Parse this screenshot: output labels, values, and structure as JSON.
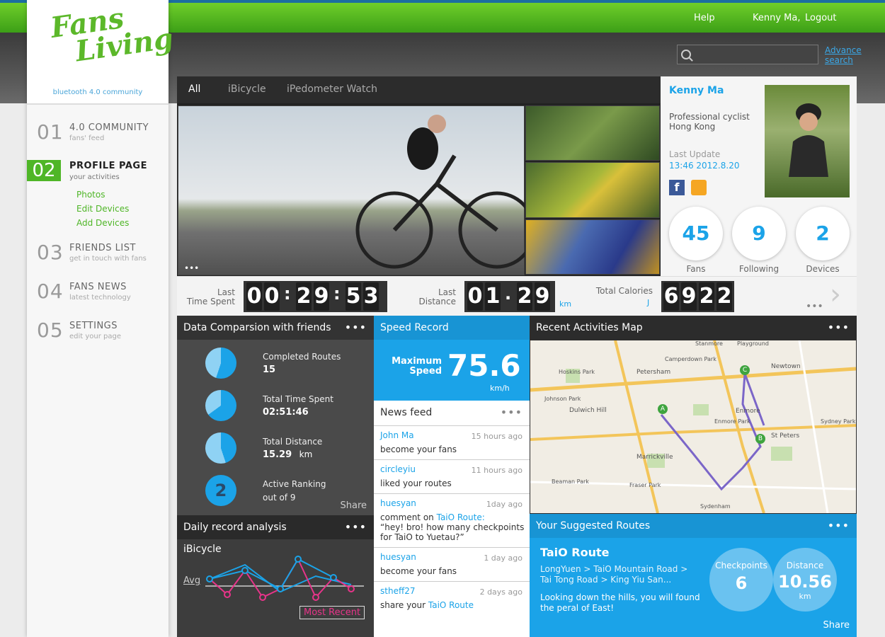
{
  "header": {
    "help": "Help",
    "user": "Kenny Ma,",
    "logout": "Logout",
    "search_placeholder": "",
    "advance_search": "Advance search"
  },
  "brand": {
    "logo_line1": "Fans",
    "logo_line2": "Living",
    "tagline": "bluetooth 4.0 community"
  },
  "nav": [
    {
      "num": "01",
      "title": "4.0 COMMUNITY",
      "sub": "fans' feed"
    },
    {
      "num": "02",
      "title": "PROFILE PAGE",
      "sub": "your activities"
    },
    {
      "num": "03",
      "title": "FRIENDS LIST",
      "sub": "get in touch with fans"
    },
    {
      "num": "04",
      "title": "FANS NEWS",
      "sub": "latest technology"
    },
    {
      "num": "05",
      "title": "SETTINGS",
      "sub": "edit your page"
    }
  ],
  "nav_sublinks": [
    "Photos",
    "Edit Devices",
    "Add Devices"
  ],
  "tabs": [
    "All",
    "iBicycle",
    "iPedometer Watch"
  ],
  "photos_more": "•••",
  "profile": {
    "name": "Kenny Ma",
    "role": "Professional cyclist",
    "location": "Hong Kong",
    "last_update_label": "Last Update",
    "last_update": "13:46 2012.8.20",
    "stats": [
      {
        "value": "45",
        "label": "Fans"
      },
      {
        "value": "9",
        "label": "Following"
      },
      {
        "value": "2",
        "label": "Devices"
      }
    ]
  },
  "statsbar": {
    "time_label1": "Last",
    "time_label2": "Time Spent",
    "time_digits": [
      "0",
      "0",
      "2",
      "9",
      "5",
      "3"
    ],
    "dist_label1": "Last",
    "dist_label2": "Distance",
    "dist_digits": [
      "0",
      "1",
      "2",
      "9"
    ],
    "dist_unit": "km",
    "cal_label": "Total Calories",
    "cal_unit": "J",
    "cal_digits": [
      "6",
      "9",
      "2",
      "2"
    ],
    "more": "•••"
  },
  "comparison": {
    "title": "Data Comparsion with friends",
    "more": "•••",
    "items": [
      {
        "label": "Completed Routes",
        "value": "15",
        "unit": "",
        "fraction": 0.55
      },
      {
        "label": "Total Time Spent",
        "value": "02:51:46",
        "unit": "",
        "fraction": 0.65
      },
      {
        "label": "Total Distance",
        "value": "15.29",
        "unit": "km",
        "fraction": 0.45
      },
      {
        "label": "Active Ranking",
        "value": "out of 9",
        "unit": "",
        "rank": "2"
      }
    ],
    "share": "Share"
  },
  "daily": {
    "title": "Daily record analysis",
    "more": "•••",
    "device": "iBicycle",
    "avg": "Avg",
    "most_recent": "Most Recent"
  },
  "speed": {
    "title": "Speed Record",
    "label1": "Maximum",
    "label2": "Speed",
    "value": "75.6",
    "unit": "km/h"
  },
  "news": {
    "title": "News feed",
    "more": "•••",
    "items": [
      {
        "name": "John Ma",
        "time": "15 hours ago",
        "text": "become your fans"
      },
      {
        "name": "circleyiu",
        "time": "11 hours ago",
        "text": "liked your routes"
      },
      {
        "name": "huesyan",
        "time": "1day ago",
        "text_pre": "comment on ",
        "link": "TaiO Route:",
        "text": "“hey! bro! how many checkpoints for TaiO to Yuetau?”"
      },
      {
        "name": "huesyan",
        "time": "1 day ago",
        "text": "become your fans"
      },
      {
        "name": "stheff27",
        "time": "2 days ago",
        "text_pre": "share your ",
        "link": "TaiO Route"
      }
    ]
  },
  "map": {
    "title": "Recent Activities Map",
    "more": "•••",
    "labels": [
      "Stanmore",
      "Playground",
      "Newtown",
      "Petersham",
      "Hoskins Park",
      "Camperdown Park",
      "Johnson Park",
      "Dulwich Hill",
      "Enmore",
      "Enmore Park",
      "Marrickville",
      "St Peters",
      "Sydney Park",
      "Beaman Park",
      "Fraser Park",
      "Sydenham"
    ],
    "markers": [
      "A",
      "B",
      "C"
    ]
  },
  "suggest": {
    "title": "Your Suggested Routes",
    "more": "•••",
    "route": "TaiO Route",
    "path": "LongYuen > TaiO Mountain Road > Tai Tong Road > King Yiu San...",
    "desc": "Looking down the hills, you will found the peral of East!",
    "checkpoints_label": "Checkpoints",
    "checkpoints": "6",
    "distance_label": "Distance",
    "distance": "10.56",
    "distance_unit": "km",
    "share": "Share"
  }
}
